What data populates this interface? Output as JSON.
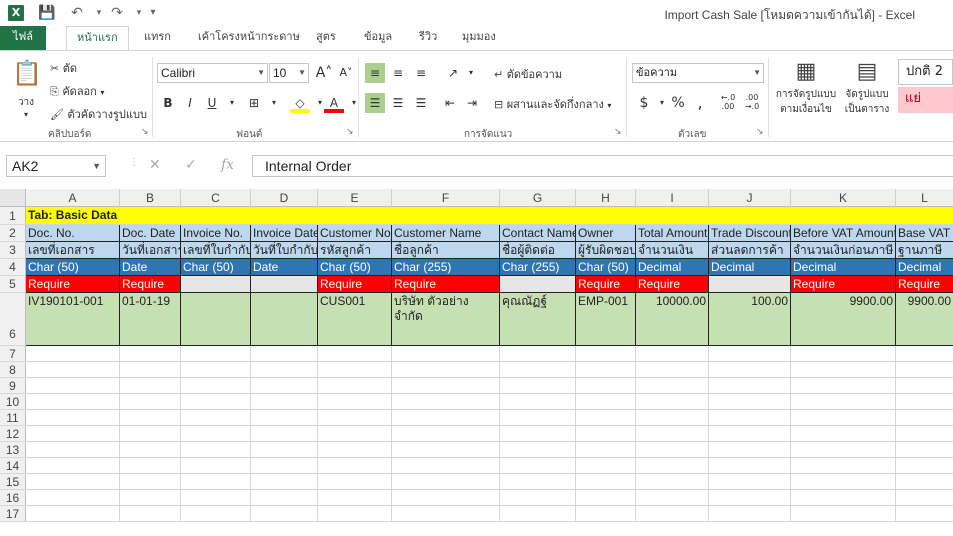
{
  "window": {
    "title": "Import Cash Sale  [โหมดความเข้ากันได้] - Excel",
    "app_icon": "excel-icon"
  },
  "tabs": [
    "ไฟล์",
    "หน้าแรก",
    "แทรก",
    "เค้าโครงหน้ากระดาษ",
    "สูตร",
    "ข้อมูล",
    "รีวิว",
    "มุมมอง"
  ],
  "ribbon": {
    "clipboard": {
      "paste": "วาง",
      "cut": "ตัด",
      "copy": "คัดลอก",
      "format_painter": "ตัวคัดวางรูปแบบ",
      "label": "คลิปบอร์ด"
    },
    "font": {
      "name": "Calibri",
      "size": "10",
      "bold": "B",
      "italic": "I",
      "underline": "U",
      "label": "ฟอนต์"
    },
    "alignment": {
      "wrap": "ตัดข้อความ",
      "merge": "ผสานและจัดกึ่งกลาง",
      "label": "การจัดแนว"
    },
    "number": {
      "format": "ข้อความ",
      "label": "ตัวเลข"
    },
    "styles": {
      "conditional_1": "การจัดรูปแบบ",
      "conditional_2": "ตามเงื่อนไข",
      "table_1": "จัดรูปแบบ",
      "table_2": "เป็นตาราง",
      "normal": "ปกติ 2",
      "bad": "แย่"
    }
  },
  "formula_bar": {
    "name_box": "AK2",
    "content": "Internal Order"
  },
  "columns": [
    "A",
    "B",
    "C",
    "D",
    "E",
    "F",
    "G",
    "H",
    "I",
    "J",
    "K",
    "L"
  ],
  "rows": [
    "1",
    "2",
    "3",
    "4",
    "5",
    "6",
    "7",
    "8",
    "9",
    "10",
    "11",
    "12",
    "13",
    "14",
    "15",
    "16",
    "17"
  ],
  "sheet": {
    "r1": "Tab: Basic Data",
    "r2": [
      "Doc. No.",
      "Doc. Date",
      "Invoice No.",
      "Invoice Date",
      "Customer No",
      "Customer Name",
      "Contact Name",
      "Owner",
      "Total Amount",
      "Trade Discount",
      "Before VAT Amount",
      "Base VAT"
    ],
    "r3": [
      "เลขที่เอกสาร",
      "วันที่เอกสาร",
      "เลขที่ใบกำกับ",
      "วันที่ใบกำกับ",
      "รหัสลูกค้า",
      "ชื่อลูกค้า",
      "ชื่อผู้ติดต่อ",
      "ผู้รับผิดชอบ",
      "จำนวนเงิน",
      "ส่วนลดการค้า",
      "จำนวนเงินก่อนภาษี",
      "ฐานภาษี"
    ],
    "r4": [
      "Char (50)",
      "Date",
      "Char (50)",
      "Date",
      "Char (50)",
      "Char (255)",
      "Char (255)",
      "Char (50)",
      "Decimal",
      "Decimal",
      "Decimal",
      "Decimal"
    ],
    "r5": [
      "Require",
      "Require",
      "",
      "",
      "Require",
      "Require",
      "",
      "Require",
      "Require",
      "",
      "Require",
      "Require"
    ],
    "r6": [
      "IV190101-001",
      "01-01-19",
      "",
      "",
      "CUS001",
      "บริษัท ตัวอย่าง จำกัด",
      "คุณณัฏฐ์",
      "EMP-001",
      "10000.00",
      "100.00",
      "9900.00",
      "9900.00"
    ]
  }
}
